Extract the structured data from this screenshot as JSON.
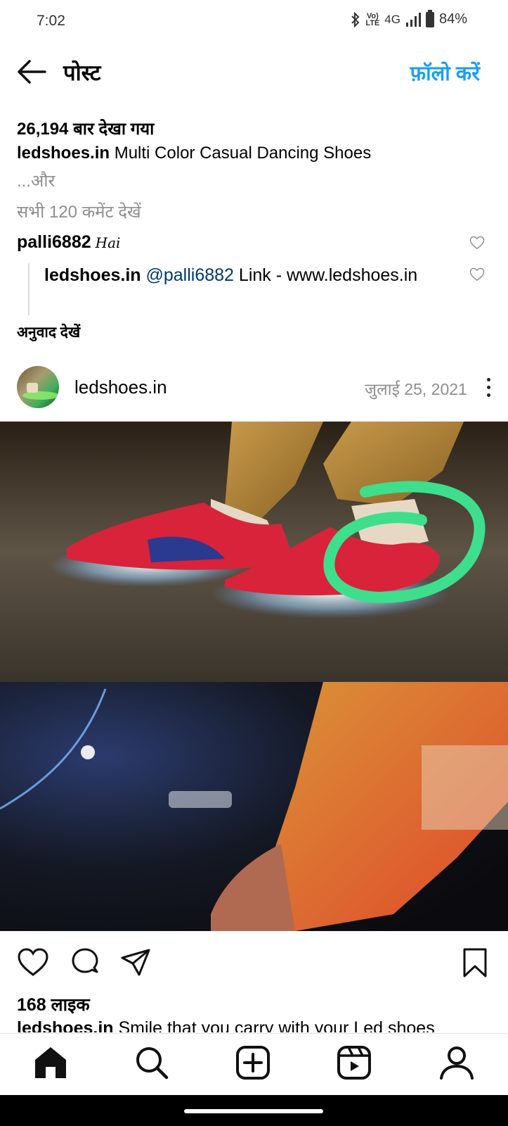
{
  "status": {
    "time": "7:02",
    "net_top": "Vo)",
    "net_bottom": "LTE",
    "gen": "4G",
    "battery": "84%"
  },
  "header": {
    "title": "पोस्ट",
    "follow": "फ़ॉलो करें"
  },
  "post_info": {
    "views": "26,194 बार देखा गया",
    "caption_user": "ledshoes.in",
    "caption_text": " Multi Color Casual Dancing Shoes",
    "more": "...और",
    "all_comments": "सभी 120 कमेंट देखें"
  },
  "comment": {
    "user": "palli6882",
    "text": "Hai"
  },
  "reply": {
    "user": "ledshoes.in",
    "mention": "@palli6882",
    "text": " Link - www.ledshoes.in"
  },
  "translate": "अनुवाद देखें",
  "post": {
    "username": "ledshoes.in",
    "date": "जुलाई 25, 2021"
  },
  "likes": "168 लाइक",
  "caption2": {
    "user": "ledshoes.in",
    "text": " Smile that you carry with your Led shoes"
  },
  "colors": {
    "accent": "#1a9ef2",
    "mention": "#00376b",
    "grey": "#8e8e8e"
  },
  "icons": [
    "back-arrow-icon",
    "heart-icon",
    "comment-icon",
    "share-icon",
    "bookmark-icon",
    "home-icon",
    "search-icon",
    "add-icon",
    "reels-icon",
    "profile-icon",
    "more-icon"
  ]
}
